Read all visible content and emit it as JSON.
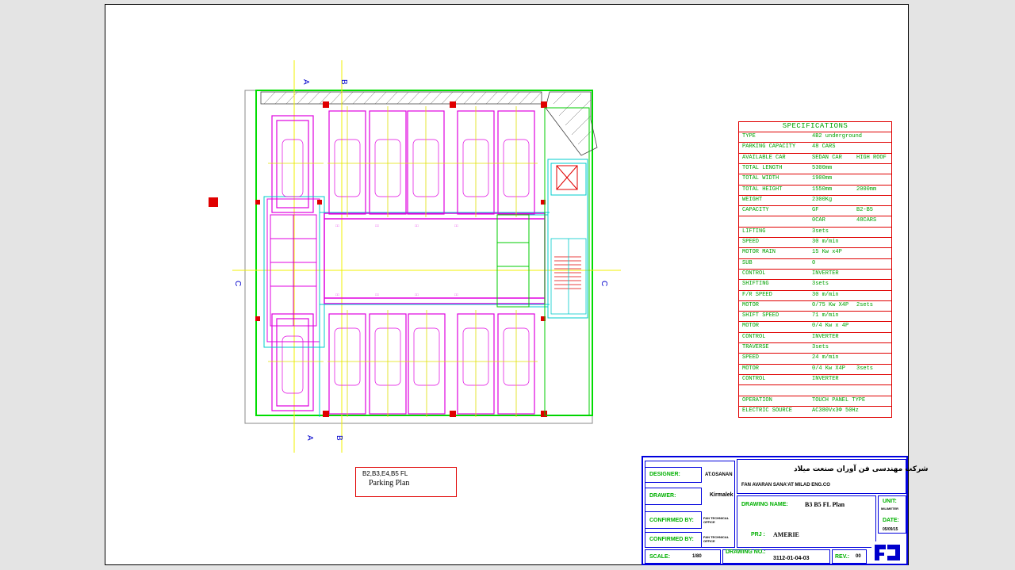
{
  "specifications": {
    "title": "SPECIFICATIONS",
    "rows": [
      {
        "label": "TYPE",
        "value": "4B2 underground"
      },
      {
        "label": "PARKING CAPACITY",
        "value": "48 CARS"
      },
      {
        "label": "AVAILABLE CAR",
        "value": "SEDAN CAR",
        "value2": "HIGH ROOF"
      },
      {
        "label": "TOTAL LENGTH",
        "value": "5300mm"
      },
      {
        "label": "TOTAL WIDTH",
        "value": "1900mm"
      },
      {
        "label": "TOTAL HEIGHT",
        "value": "1550mm",
        "value2": "2000mm"
      },
      {
        "label": "WEIGHT",
        "value": "2300Kg"
      },
      {
        "label": "CAPACITY",
        "value": "GF",
        "value2": "B2-B5"
      },
      {
        "label": "",
        "value": "0CAR",
        "value2": "48CARS"
      },
      {
        "label": "LIFTING",
        "value": "3sets"
      },
      {
        "label": "SPEED",
        "value": "30 m/min"
      },
      {
        "label": "MOTOR  MAIN",
        "value": "15 Kw x4P"
      },
      {
        "label": "SUB",
        "value": "0"
      },
      {
        "label": "CONTROL",
        "value": "INVERTER"
      },
      {
        "label": "SHIFTING",
        "value": "3sets"
      },
      {
        "label": "F/R  SPEED",
        "value": "30 m/min"
      },
      {
        "label": "MOTOR",
        "value": "0/75 Kw X4P",
        "value2": "2sets"
      },
      {
        "label": "SHIFT  SPEED",
        "value": "71 m/min"
      },
      {
        "label": "MOTOR",
        "value": "0/4 Kw x 4P"
      },
      {
        "label": "CONTROL",
        "value": "INVERTER"
      },
      {
        "label": "TRAVERSE",
        "value": "3sets"
      },
      {
        "label": "SPEED",
        "value": "24 m/min"
      },
      {
        "label": "MOTOR",
        "value": "0/4 Kw X4P",
        "value2": "3sets"
      },
      {
        "label": "CONTROL",
        "value": "INVERTER"
      },
      {
        "label": "",
        "value": ""
      },
      {
        "label": "OPERATION",
        "value": "TOUCH PANEL TYPE"
      },
      {
        "label": "ELECTRIC SOURCE",
        "value": "AC380Vx3Φ 50Hz"
      }
    ]
  },
  "caption": {
    "floors": "B2,B3,E4,B5 FL",
    "name": "Parking Plan"
  },
  "sections": {
    "a": "A",
    "b": "B",
    "c": "C"
  },
  "titleblock": {
    "company_fa": "شرکت مهندسی فن آوران صنعت میلاد",
    "company_en": "FAN AVARAN SANA'AT MILAD ENG.CO",
    "designer_label": "DESIGNER:",
    "designer_value": "AT.OSANAN",
    "drawer_label": "DRAWER:",
    "drawer_value": "Kirmalek",
    "confirmed1_label": "CONFIRMED BY:",
    "confirmed1_value": "FAN TECHNICAL OFFICE",
    "confirmed2_label": "CONFIRMED BY:",
    "confirmed2_value": "FAN TECHNICAL OFFICE",
    "drawing_name_label": "DRAWING NAME:",
    "drawing_name_value": "B3 B5  FL  Plan",
    "project_label": "PRJ :",
    "project_value": "AMERIE",
    "unit_label": "UNIT:",
    "unit_value": "MILIMETER",
    "date_label": "DATE:",
    "date_value": "05/09/15",
    "scale_label": "SCALE:",
    "scale_value": "1/80",
    "drawing_no_label": "DRAWING  NO.:",
    "drawing_no_value": "3112-01-04-03",
    "rev_label": "REV.:",
    "rev_value": "00"
  }
}
